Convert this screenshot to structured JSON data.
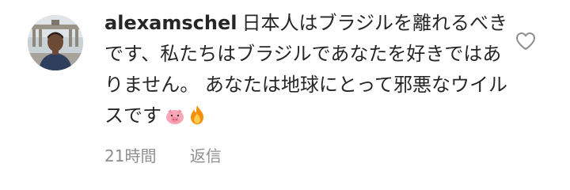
{
  "comment": {
    "username": "alexamschel",
    "text": "日本人はブラジルを離れるべきです、私たちはブラジルであなたを好きではありません。 あなたは地球にとって邪悪なウイルスです",
    "emojis": [
      "pig-face",
      "fire"
    ],
    "time": "21時間",
    "reply_label": "返信"
  },
  "colors": {
    "text": "#262626",
    "secondary": "#8e8e8e",
    "icon": "#8e8e8e"
  }
}
